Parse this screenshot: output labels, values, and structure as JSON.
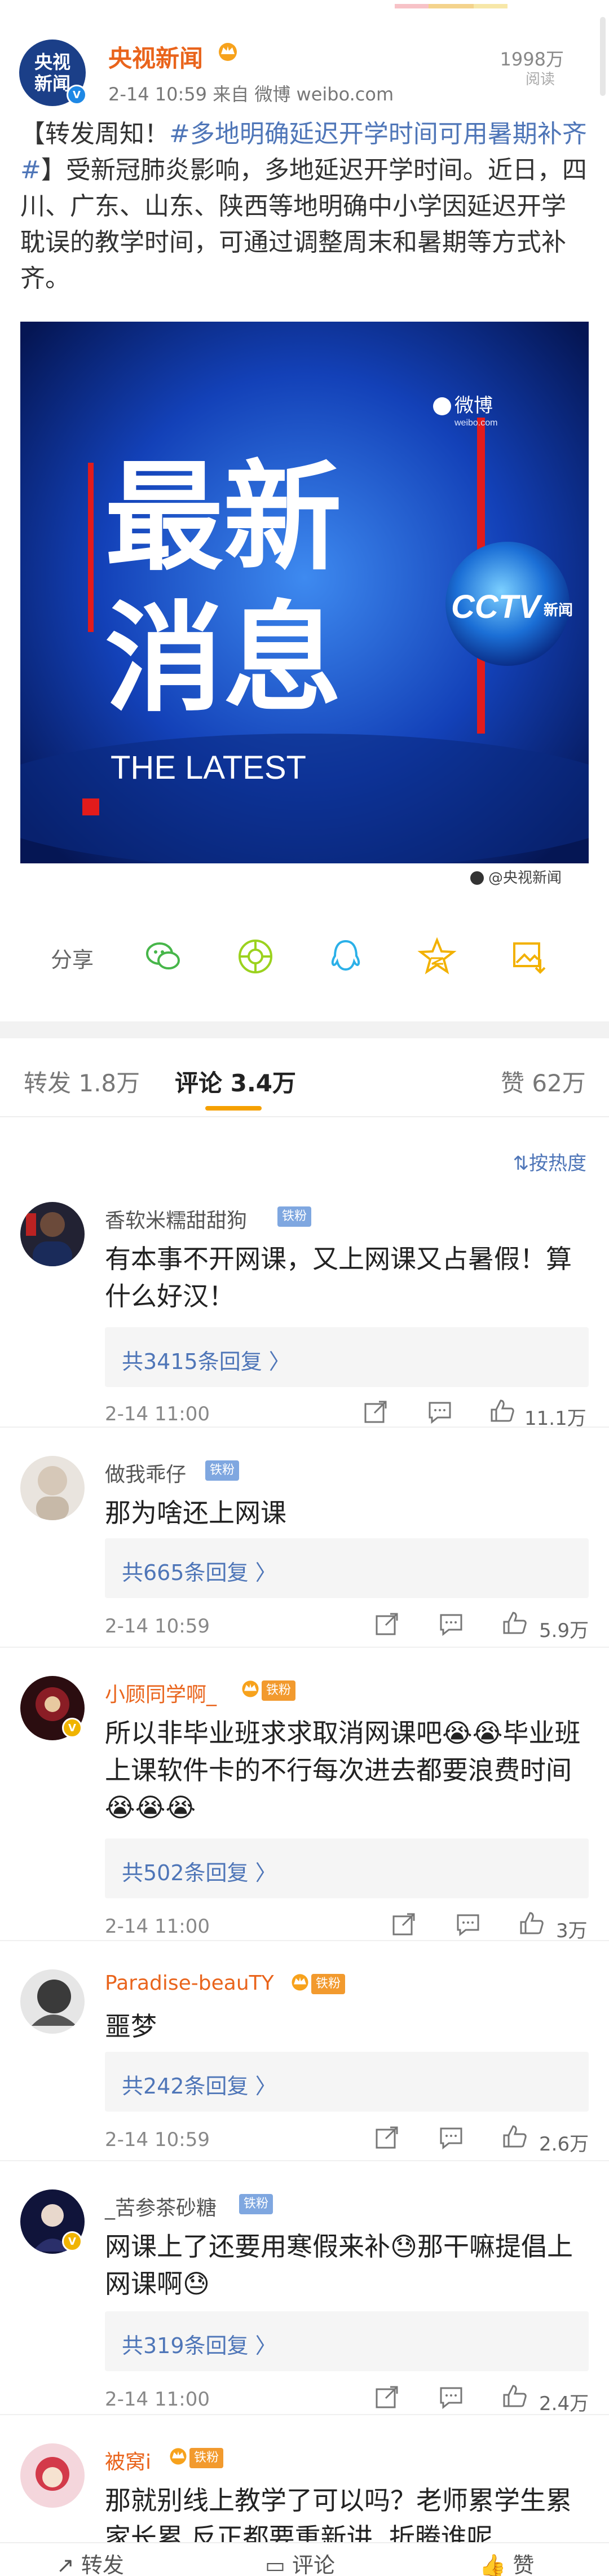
{
  "post": {
    "author": "央视新闻",
    "avatar_text_line1": "央视",
    "avatar_text_line2": "新闻",
    "meta": "2-14 10:59  来自 微博 weibo.com",
    "read_count": "1998万",
    "read_label": "阅读",
    "text_lead": "【转发周知！",
    "text_tag": "#多地明确延迟开学时间可用暑期补齐#",
    "text_body": "】受新冠肺炎影响，多地延迟开学时间。近日，四川、广东、山东、陕西等地明确中小学因延迟开学耽误的教学时间，可通过调整周末和暑期等方式补齐。",
    "image": {
      "headline_line1": "最新",
      "headline_line2": "消息",
      "subtitle": "THE LATEST",
      "logo_text": "微博",
      "logo_sub": "weibo.com",
      "cctv_text": "CCTV",
      "cctv_news": "新闻",
      "watermark": "@央视新闻"
    }
  },
  "share": {
    "label": "分享",
    "icons": [
      "wechat-icon",
      "moments-icon",
      "qq-icon",
      "qzone-icon",
      "save-image-icon"
    ]
  },
  "tabs": {
    "repost": "转发 1.8万",
    "comment": "评论 3.4万",
    "like": "赞 62万"
  },
  "sort": {
    "label": "按热度"
  },
  "colors": {
    "accent": "#f5a000",
    "link": "#4f76b8",
    "author_orange": "#e9641c"
  },
  "comments": [
    {
      "name": "香软米糯甜甜狗",
      "badge": "铁粉",
      "text": "有本事不开网课，又上网课又占暑假！算什么好汉！",
      "replies": "共3415条回复 〉",
      "time": "2-14 11:00",
      "likes": "11.1万"
    },
    {
      "name": "做我乖仔",
      "badge": "铁粉",
      "text": "那为啥还上网课",
      "replies": "共665条回复 〉",
      "time": "2-14 10:59",
      "likes": "5.9万"
    },
    {
      "name": "小顾同学啊_",
      "badge": "铁粉",
      "text": "所以非毕业班求求取消网课吧😭😭毕业班上课软件卡的不行每次进去都要浪费时间😭😭😭",
      "replies": "共502条回复 〉",
      "time": "2-14 11:00",
      "likes": "3万"
    },
    {
      "name": "Paradise-beauTY",
      "badge": "铁粉",
      "text": "噩梦",
      "replies": "共242条回复 〉",
      "time": "2-14 10:59",
      "likes": "2.6万"
    },
    {
      "name": "_苦参茶砂糖",
      "badge": "铁粉",
      "text": "网课上了还要用寒假来补😓那干嘛提倡上网课啊😓",
      "replies": "共319条回复 〉",
      "time": "2-14 11:00",
      "likes": "2.4万"
    },
    {
      "name": "被窝i",
      "badge": "铁粉",
      "text": "那就别线上教学了可以吗？老师累学生累家长累 反正都要重新讲. 折腾谁呢",
      "replies": "",
      "time": "",
      "likes": ""
    }
  ],
  "bottom_bar": {
    "repost": "转发",
    "comment": "评论",
    "like": "赞"
  }
}
